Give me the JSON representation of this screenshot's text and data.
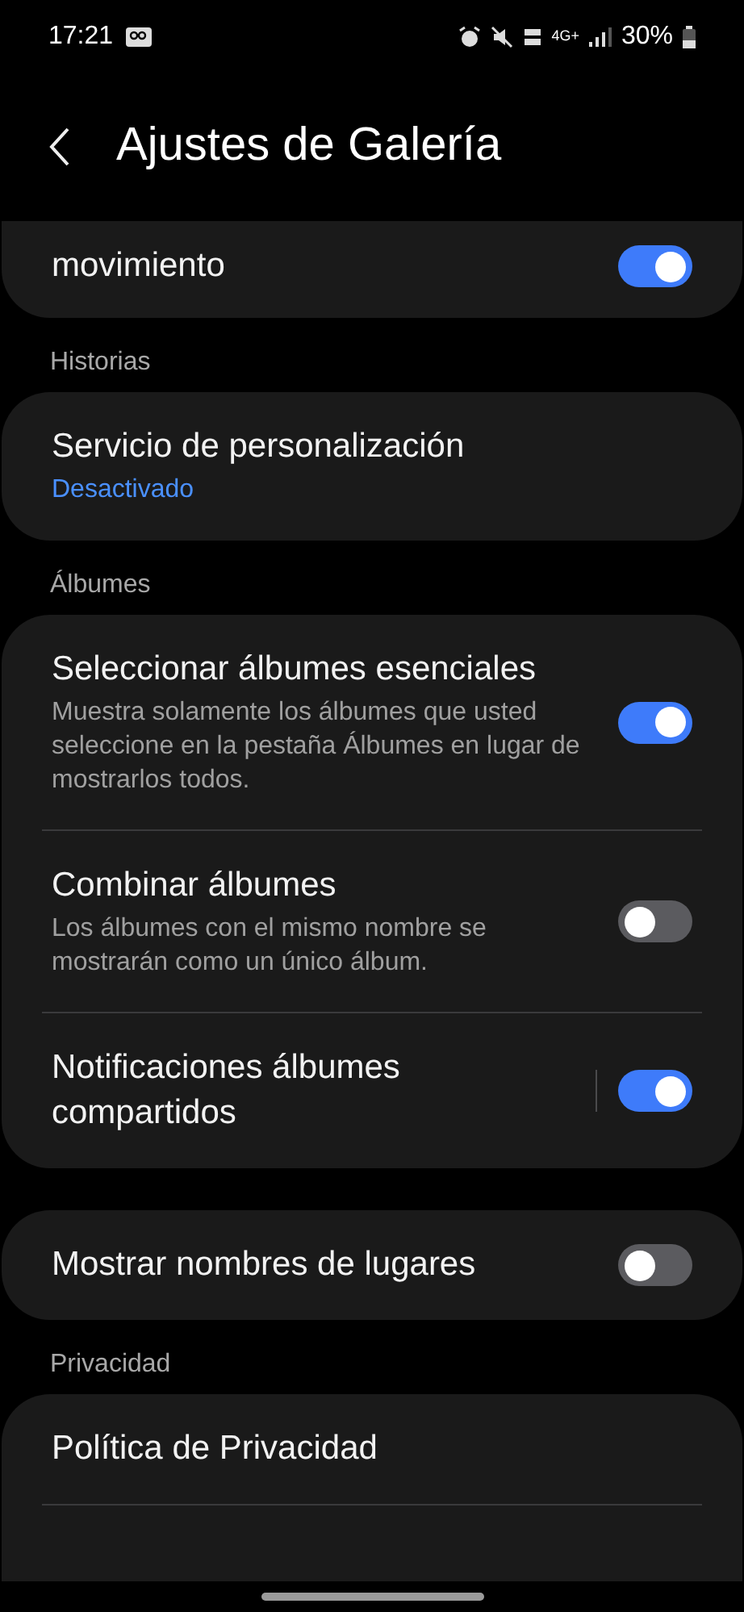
{
  "status_bar": {
    "time": "17:21",
    "network": "4G+",
    "battery": "30%"
  },
  "header": {
    "title": "Ajustes de Galería"
  },
  "sections": [
    {
      "items": [
        {
          "kind": "toggle",
          "title": "movimiento",
          "on": true
        }
      ]
    },
    {
      "label": "Historias",
      "items": [
        {
          "kind": "link",
          "title": "Servicio de personalización",
          "value": "Desactivado"
        }
      ]
    },
    {
      "label": "Álbumes",
      "items": [
        {
          "kind": "toggle",
          "title": "Seleccionar álbumes esenciales",
          "subtitle": "Muestra solamente los álbumes que usted seleccione en la pestaña Álbumes en lugar de mostrarlos todos.",
          "on": true
        },
        {
          "kind": "toggle",
          "title": "Combinar álbumes",
          "subtitle": "Los álbumes con el mismo nombre se mostrarán como un único álbum.",
          "on": false
        },
        {
          "kind": "split-toggle",
          "title": "Notificaciones álbumes compartidos",
          "on": true
        }
      ]
    },
    {
      "items": [
        {
          "kind": "toggle",
          "title": "Mostrar nombres de lugares",
          "on": false
        }
      ]
    },
    {
      "label": "Privacidad",
      "items": [
        {
          "kind": "link",
          "title": "Política de Privacidad"
        }
      ]
    }
  ]
}
